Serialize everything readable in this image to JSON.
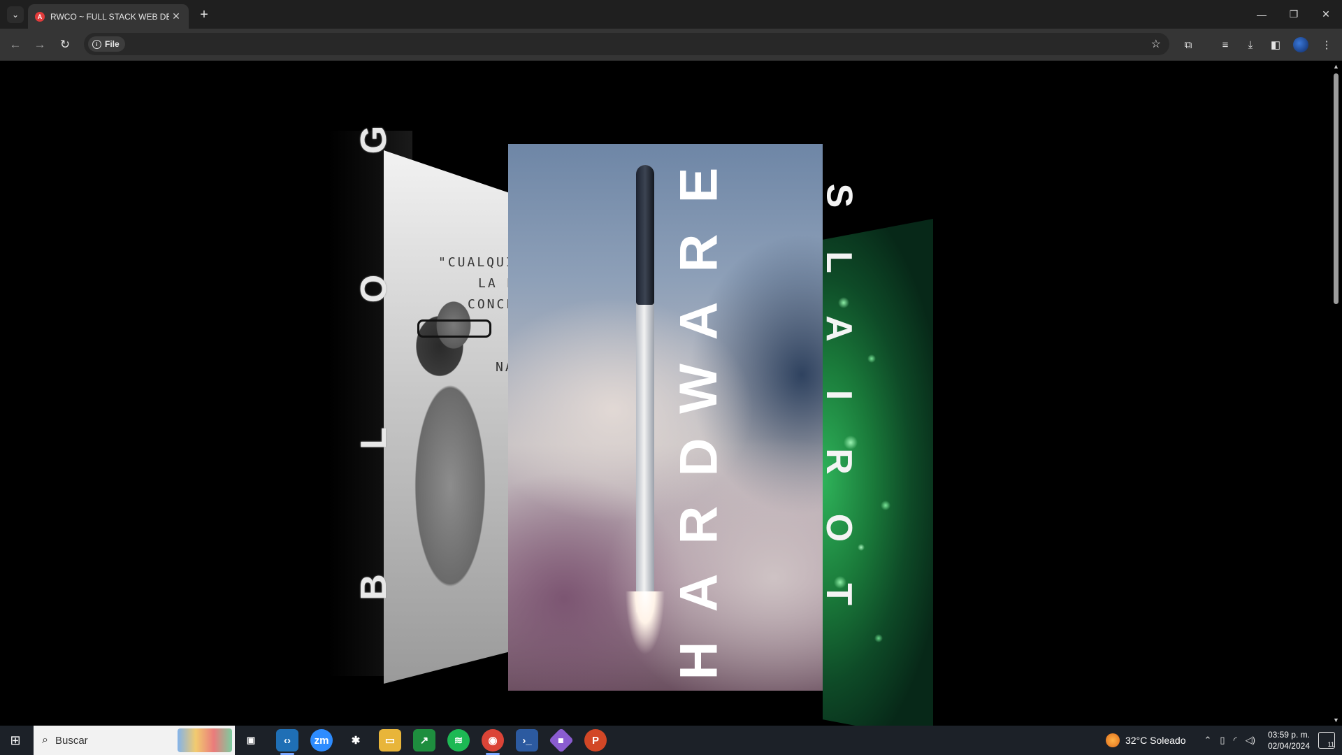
{
  "browser": {
    "tab_title": "RWCO ~ FULL STACK WEB DEV",
    "favicon_letter": "A",
    "new_tab_label": "+",
    "site_chip_label": "File",
    "window_controls": {
      "minimize": "—",
      "restore": "❐",
      "close": "✕"
    }
  },
  "page": {
    "cards": [
      {
        "name": "blog",
        "letters": [
          "G",
          "O",
          "L",
          "B"
        ]
      },
      {
        "name": "hardware",
        "letters": [
          "E",
          "R",
          "A",
          "W",
          "D",
          "R",
          "A",
          "H"
        ]
      },
      {
        "name": "tutorials",
        "letters": [
          "S",
          "L",
          "A",
          "I",
          "R",
          "O",
          "T"
        ]
      }
    ],
    "blog_quote_lines": [
      "\"CUALQUI",
      "LA N",
      "CONCE",
      "NA"
    ]
  },
  "taskbar": {
    "search_placeholder": "Buscar",
    "weather": "32°C  Soleado",
    "time": "03:59 p. m.",
    "date": "02/04/2024",
    "notification_count": "11",
    "apps": [
      "task-view",
      "vscode",
      "zoom",
      "slack",
      "file-explorer",
      "sheets",
      "spotify",
      "chrome",
      "powershell",
      "git",
      "powerpoint"
    ]
  },
  "colors": {
    "chrome_dark": "#1f1f1f",
    "toolbar": "#353535",
    "taskbar": "#1c2128",
    "accent": "#7aa7ff"
  }
}
